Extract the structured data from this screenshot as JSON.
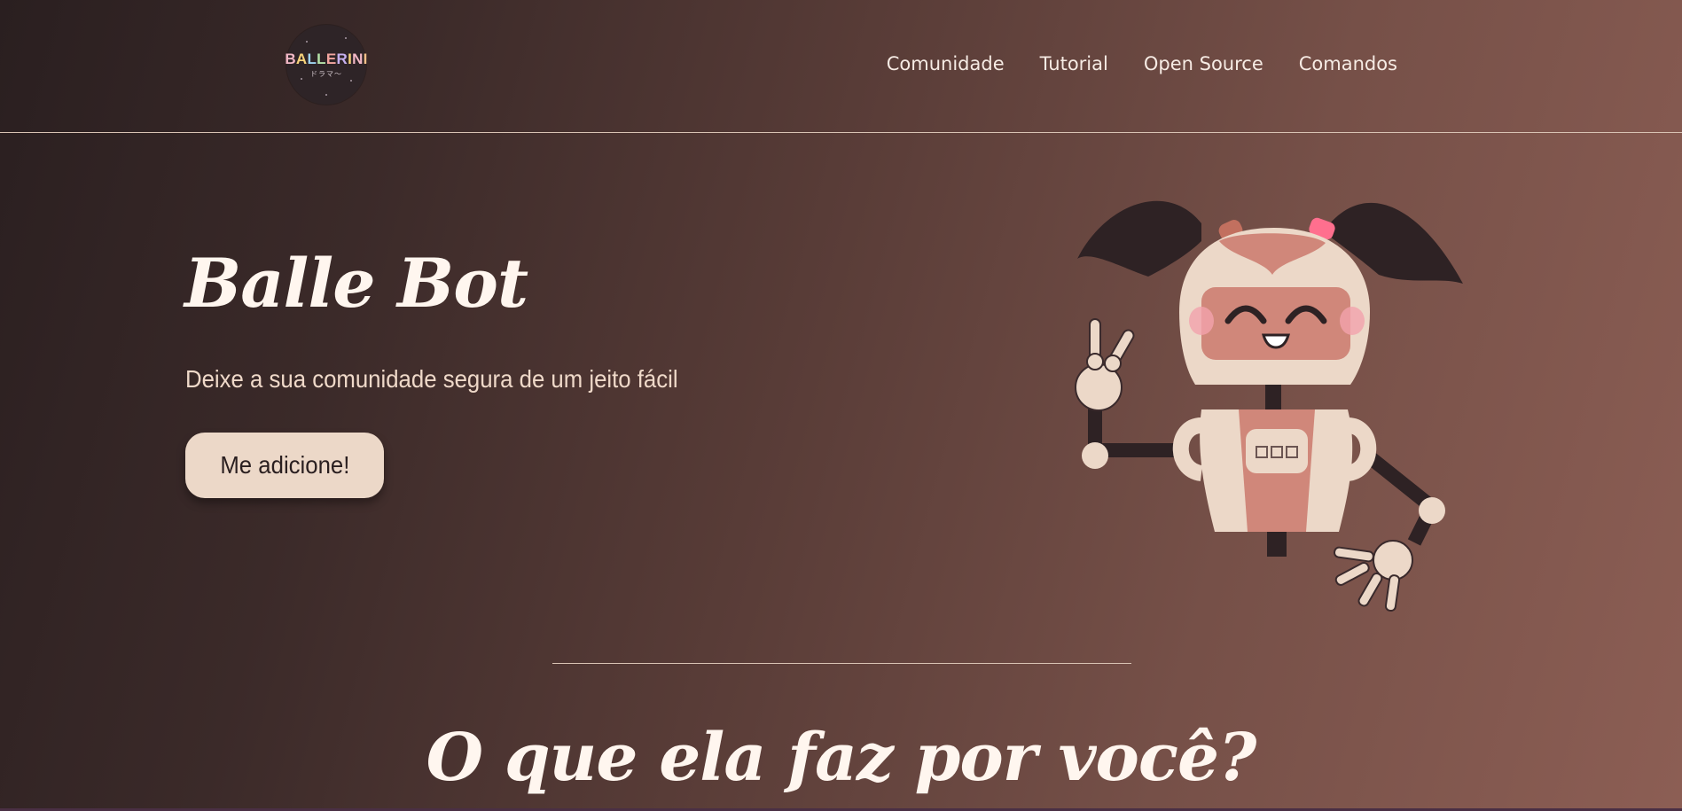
{
  "logo": {
    "letters": [
      {
        "char": "B",
        "color": "#f2b8c6"
      },
      {
        "char": "A",
        "color": "#f5d27a"
      },
      {
        "char": "L",
        "color": "#9fd3ef"
      },
      {
        "char": "L",
        "color": "#b5e3a8"
      },
      {
        "char": "E",
        "color": "#f3a6a0"
      },
      {
        "char": "R",
        "color": "#c6b0ef"
      },
      {
        "char": "I",
        "color": "#f5d27a"
      },
      {
        "char": "N",
        "color": "#f2b8c6"
      },
      {
        "char": "I",
        "color": "#f3c089"
      }
    ],
    "sub": "ドラマ〜"
  },
  "nav": {
    "items": [
      "Comunidade",
      "Tutorial",
      "Open Source",
      "Comandos"
    ]
  },
  "hero": {
    "title": "Balle Bot",
    "subtitle": "Deixe a sua comunidade segura de um jeito fácil",
    "cta_label": "Me adicione!"
  },
  "section": {
    "title": "O que ela faz por você?"
  },
  "colors": {
    "accent": "#ecd8c8",
    "robot_pink": "#d0877a",
    "robot_dark": "#2e2224",
    "bow": "#ff6f8e"
  }
}
